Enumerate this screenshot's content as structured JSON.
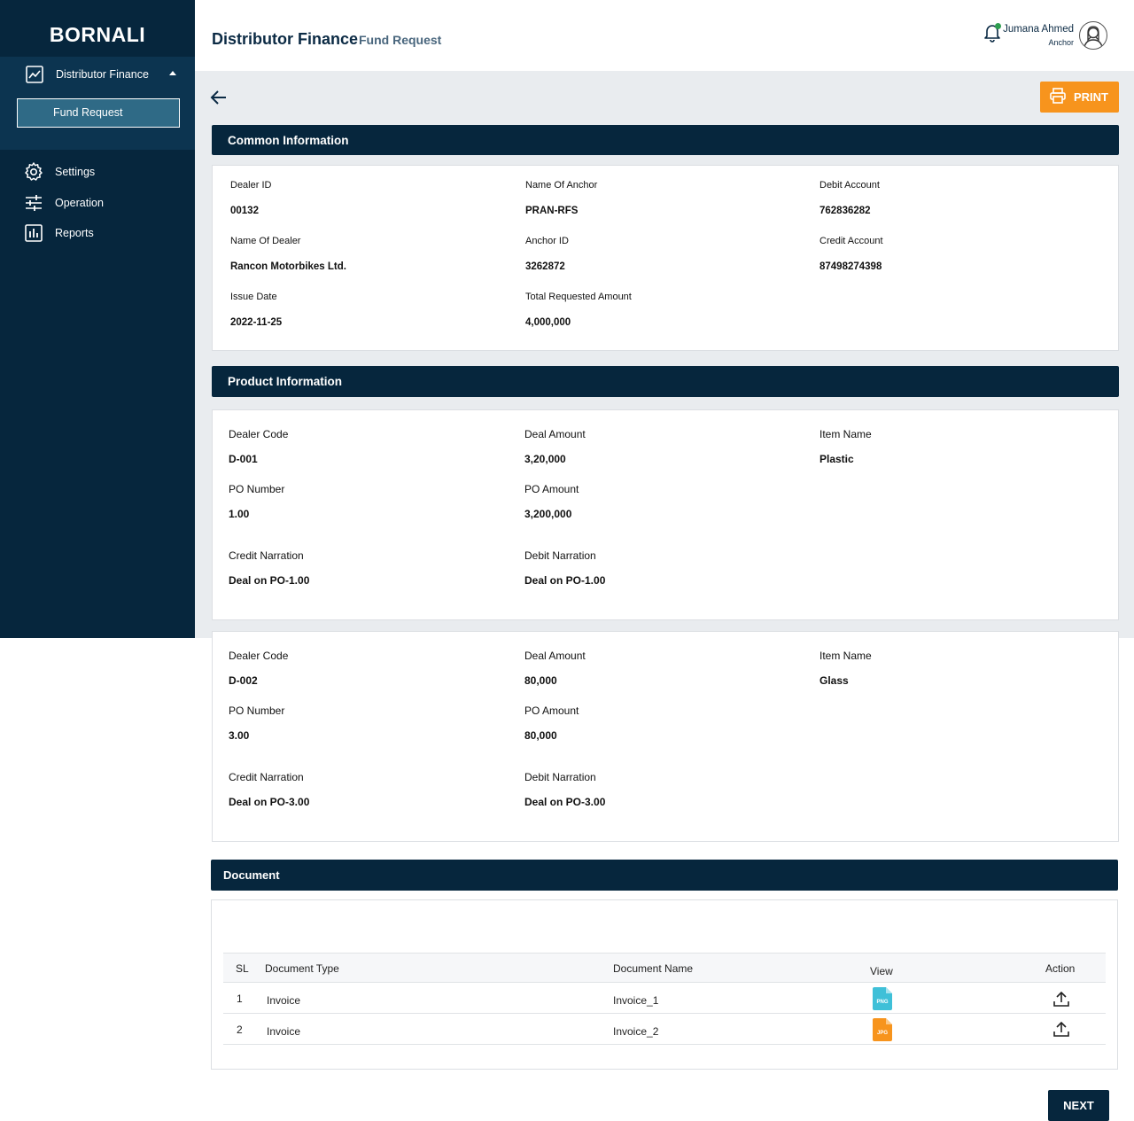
{
  "sidebar": {
    "brand": "BORNALI",
    "group_label": "Distributor Finance",
    "sub_item": "Fund Request",
    "items": [
      {
        "label": "Settings",
        "icon": "gear-icon"
      },
      {
        "label": "Operation",
        "icon": "sliders-icon"
      },
      {
        "label": "Reports",
        "icon": "bar-chart-icon"
      }
    ]
  },
  "header": {
    "title": "Distributor Finance",
    "subtitle": "Fund Request",
    "user_name": "Jumana Ahmed",
    "user_role": "Anchor"
  },
  "toolbar": {
    "print_label": "PRINT"
  },
  "common": {
    "heading": "Common Information",
    "fields": [
      {
        "label": "Dealer ID",
        "value": "00132"
      },
      {
        "label": "Name Of Anchor",
        "value": "PRAN-RFS"
      },
      {
        "label": "Debit Account",
        "value": "762836282"
      },
      {
        "label": "Name Of Dealer",
        "value": "Rancon Motorbikes Ltd."
      },
      {
        "label": "Anchor ID",
        "value": "3262872"
      },
      {
        "label": "Credit Account",
        "value": "87498274398"
      },
      {
        "label": "Issue Date",
        "value": "2022-11-25"
      },
      {
        "label": "Total Requested Amount",
        "value": "4,000,000"
      }
    ]
  },
  "product": {
    "heading": "Product Information",
    "items": [
      {
        "dealer_code_label": "Dealer Code",
        "dealer_code": "D-001",
        "deal_amount_label": "Deal Amount",
        "deal_amount": "3,20,000",
        "item_name_label": "Item Name",
        "item_name": "Plastic",
        "po_number_label": "PO Number",
        "po_number": "1.00",
        "po_amount_label": "PO Amount",
        "po_amount": "3,200,000",
        "credit_narration_label": "Credit Narration",
        "credit_narration": "Deal on PO-1.00",
        "debit_narration_label": "Debit Narration",
        "debit_narration": "Deal on PO-1.00"
      },
      {
        "dealer_code_label": "Dealer Code",
        "dealer_code": "D-002",
        "deal_amount_label": "Deal Amount",
        "deal_amount": "80,000",
        "item_name_label": "Item Name",
        "item_name": "Glass",
        "po_number_label": "PO Number",
        "po_number": "3.00",
        "po_amount_label": "PO Amount",
        "po_amount": "80,000",
        "credit_narration_label": "Credit Narration",
        "credit_narration": "Deal on PO-3.00",
        "debit_narration_label": "Debit Narration",
        "debit_narration": "Deal on PO-3.00"
      }
    ]
  },
  "document": {
    "heading": "Document",
    "columns": [
      "SL",
      "Document Type",
      "Document Name",
      "View",
      "Action"
    ],
    "rows": [
      {
        "sl": "1",
        "type": "Invoice",
        "name": "Invoice_1",
        "file_badge": "PNG",
        "file_color": "#3fc0d8"
      },
      {
        "sl": "2",
        "type": "Invoice",
        "name": "Invoice_2",
        "file_badge": "JPG",
        "file_color": "#f7941d"
      }
    ]
  },
  "footer": {
    "next_label": "NEXT"
  },
  "colors": {
    "navy": "#06263d",
    "accent_orange": "#f7941d",
    "selected_teal": "#2f6a86"
  }
}
